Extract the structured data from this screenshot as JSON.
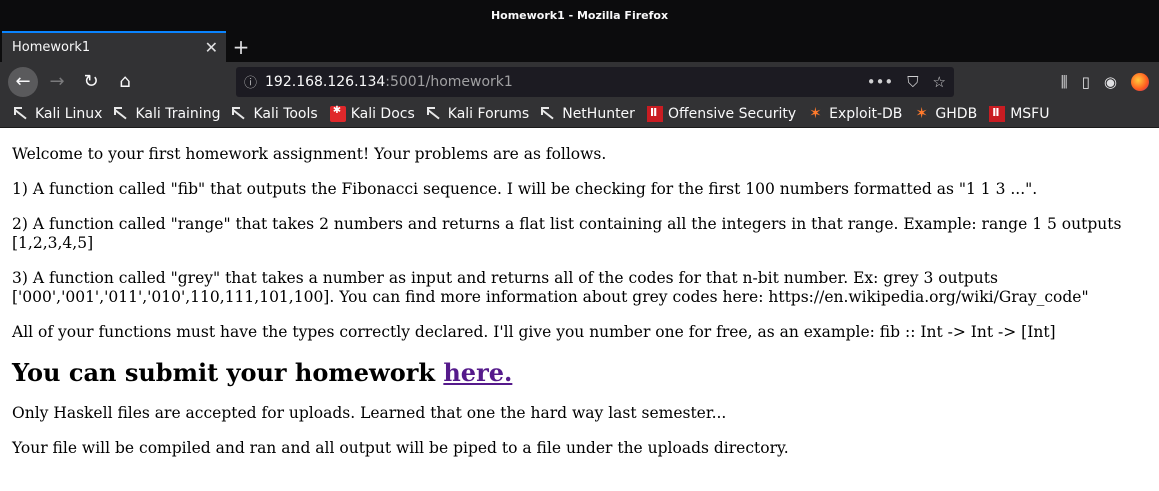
{
  "window": {
    "title": "Homework1 - Mozilla Firefox"
  },
  "tabs": [
    {
      "label": "Homework1"
    }
  ],
  "url": {
    "host": "192.168.126.134",
    "path": ":5001/homework1"
  },
  "bookmarks": [
    {
      "label": "Kali Linux",
      "icon": "kali-dragon-icon"
    },
    {
      "label": "Kali Training",
      "icon": "kali-dragon-icon"
    },
    {
      "label": "Kali Tools",
      "icon": "kali-dragon-icon"
    },
    {
      "label": "Kali Docs",
      "icon": "kali-docs-icon"
    },
    {
      "label": "Kali Forums",
      "icon": "kali-dragon-icon"
    },
    {
      "label": "NetHunter",
      "icon": "kali-dragon-icon"
    },
    {
      "label": "Offensive Security",
      "icon": "offsec-icon"
    },
    {
      "label": "Exploit-DB",
      "icon": "exploit-db-icon"
    },
    {
      "label": "GHDB",
      "icon": "exploit-db-icon"
    },
    {
      "label": "MSFU",
      "icon": "offsec-icon"
    }
  ],
  "content": {
    "intro": "Welcome to your first homework assignment! Your problems are as follows.",
    "p1": "1) A function called \"fib\" that outputs the Fibonacci sequence. I will be checking for the first 100 numbers formatted as \"1 1 3 ...\".",
    "p2": "2) A function called \"range\" that takes 2 numbers and returns a flat list containing all the integers in that range. Example: range 1 5 outputs [1,2,3,4,5]",
    "p3": "3) A function called \"grey\" that takes a number as input and returns all of the codes for that n-bit number. Ex: grey 3 outputs ['000','001','011','010',110,111,101,100]. You can find more information about grey codes here: https://en.wikipedia.org/wiki/Gray_code\"",
    "p4": "All of your functions must have the types correctly declared. I'll give you number one for free, as an example: fib :: Int -> Int -> [Int]",
    "heading_text": "You can submit your homework ",
    "heading_link": "here.",
    "p5": "Only Haskell files are accepted for uploads. Learned that one the hard way last semester...",
    "p6": "Your file will be compiled and ran and all output will be piped to a file under the uploads directory."
  },
  "colors": {
    "accent": "#0a84ff",
    "link_visited": "#551a8b",
    "chrome_dark": "#323234"
  }
}
